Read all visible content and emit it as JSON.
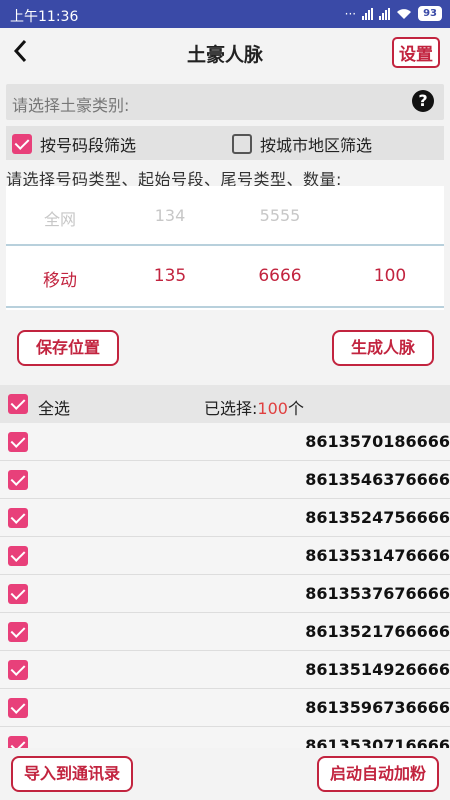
{
  "status": {
    "time": "上午11:36",
    "dots": "···",
    "battery": "93"
  },
  "header": {
    "title": "土豪人脉",
    "settings_label": "设置"
  },
  "type_select": {
    "placeholder": "请选择土豪类别:",
    "help": "?"
  },
  "filters": {
    "by_number": {
      "label": "按号码段筛选",
      "checked": true
    },
    "by_city": {
      "label": "按城市地区筛选",
      "checked": false
    }
  },
  "instruction": "请选择号码类型、起始号段、尾号类型、数量:",
  "picker": {
    "above": [
      "全网",
      "134",
      "5555",
      ""
    ],
    "selected": [
      "移动",
      "135",
      "6666",
      "100"
    ]
  },
  "actions": {
    "save": "保存位置",
    "generate": "生成人脉"
  },
  "list_header": {
    "select_all": "全选",
    "count_prefix": "已选择:",
    "count": "100",
    "count_suffix": "个"
  },
  "numbers": [
    "8613570186666",
    "8613546376666",
    "8613524756666",
    "8613531476666",
    "8613537676666",
    "8613521766666",
    "8613514926666",
    "8613596736666",
    "8613530716666"
  ],
  "footer": {
    "import": "导入到通讯录",
    "auto_add": "启动自动加粉"
  },
  "colors": {
    "accent": "#c2243f",
    "checkbox": "#e8407a",
    "statusbar": "#3a4aa7"
  }
}
